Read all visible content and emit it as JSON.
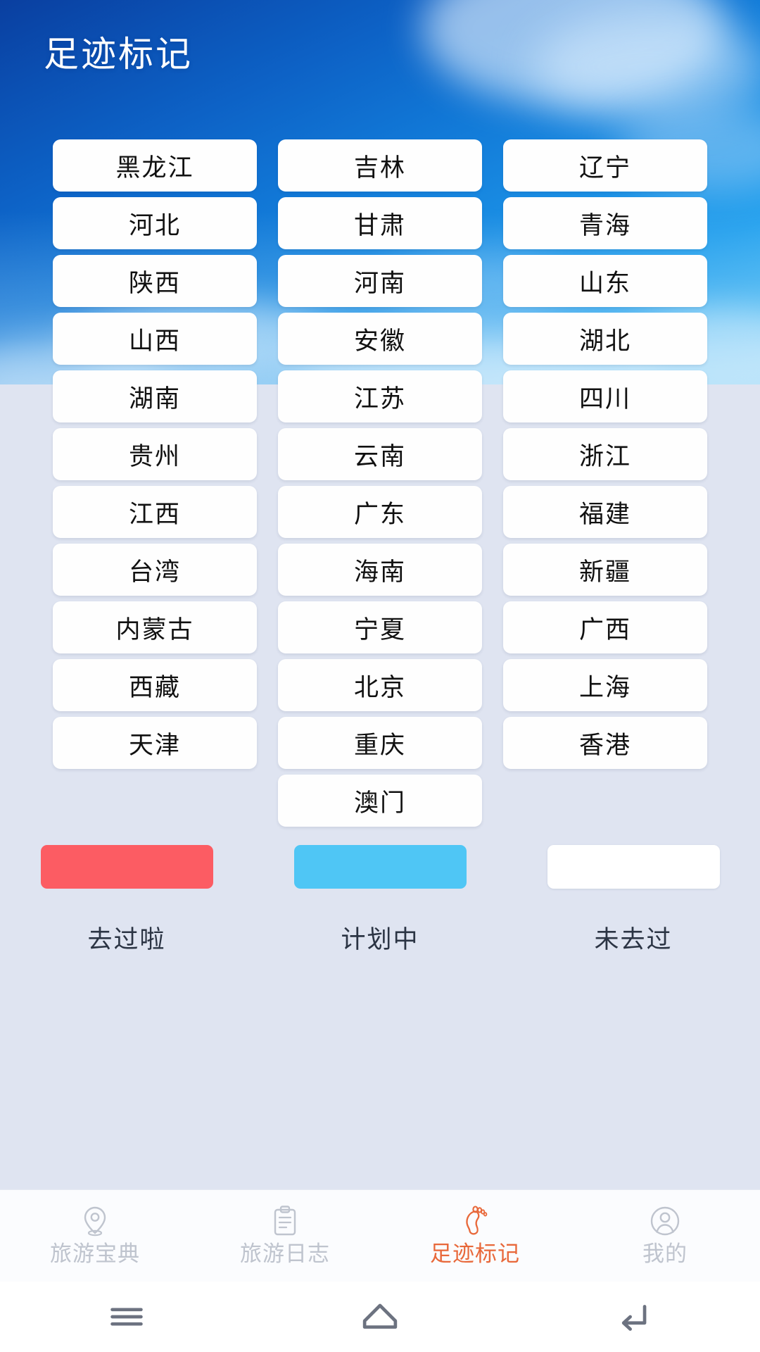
{
  "header": {
    "title": "足迹标记"
  },
  "theme": {
    "sky_top": "#0a3fa0",
    "sky_bottom": "#5ec3f4",
    "page_background": "#DFE4F1",
    "card_background": "#FEFEFE",
    "card_text": "#111111",
    "accent_active": "#E8683A",
    "tab_inactive": "#BFC4CE"
  },
  "grid": {
    "columns": 3,
    "provinces": [
      "黑龙江",
      "吉林",
      "辽宁",
      "河北",
      "甘肃",
      "青海",
      "陕西",
      "河南",
      "山东",
      "山西",
      "安徽",
      "湖北",
      "湖南",
      "江苏",
      "四川",
      "贵州",
      "云南",
      "浙江",
      "江西",
      "广东",
      "福建",
      "台湾",
      "海南",
      "新疆",
      "内蒙古",
      "宁夏",
      "广西",
      "西藏",
      "北京",
      "上海",
      "天津",
      "重庆",
      "香港",
      "",
      "澳门",
      ""
    ]
  },
  "legend": {
    "items": [
      {
        "label": "去过啦",
        "color": "#FC5C63",
        "state": "visited"
      },
      {
        "label": "计划中",
        "color": "#4FC6F5",
        "state": "planned"
      },
      {
        "label": "未去过",
        "color": "#FFFFFF",
        "state": "not-visited"
      }
    ]
  },
  "tabbar": {
    "items": [
      {
        "label": "旅游宝典",
        "icon": "location-pin-icon",
        "active": false
      },
      {
        "label": "旅游日志",
        "icon": "clipboard-icon",
        "active": false
      },
      {
        "label": "足迹标记",
        "icon": "footprint-icon",
        "active": true
      },
      {
        "label": "我的",
        "icon": "user-circle-icon",
        "active": false
      }
    ]
  },
  "system_nav": {
    "items": [
      {
        "name": "recents-button",
        "icon": "menu-lines-icon"
      },
      {
        "name": "home-button",
        "icon": "home-icon"
      },
      {
        "name": "back-button",
        "icon": "back-arrow-icon"
      }
    ]
  }
}
